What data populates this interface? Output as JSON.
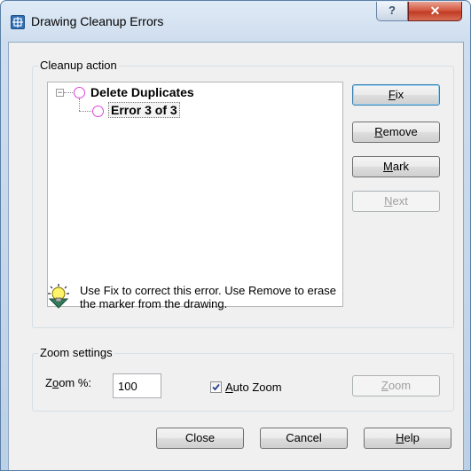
{
  "window": {
    "title": "Drawing Cleanup Errors",
    "help_glyph": "?",
    "close_glyph": "✕"
  },
  "cleanup": {
    "group_label": "Cleanup action",
    "tree": {
      "expander_glyph": "−",
      "root_label": "Delete Duplicates",
      "child_label": "Error 3 of 3",
      "marker_color": "#e043e0"
    },
    "buttons": {
      "fix": {
        "acc": "F",
        "rest": "ix"
      },
      "remove": {
        "acc": "R",
        "rest": "emove"
      },
      "mark": {
        "acc": "M",
        "rest": "ark"
      },
      "next": {
        "acc": "N",
        "rest": "ext"
      }
    },
    "info_text_line1": "Use Fix to correct this error. Use Remove to erase",
    "info_text_line2": " the  marker from the drawing."
  },
  "zoom": {
    "group_label": "Zoom settings",
    "zoom_label_pre": "Z",
    "zoom_label_acc": "o",
    "zoom_label_post": "om %:",
    "zoom_value": "100",
    "auto_zoom": {
      "checked": true,
      "acc": "A",
      "rest": "uto Zoom"
    },
    "zoom_button": {
      "acc": "Z",
      "rest": "oom"
    }
  },
  "footer": {
    "close_label": "Close",
    "cancel_label": "Cancel",
    "help": {
      "acc": "H",
      "rest": "elp"
    }
  },
  "colors": {
    "title_close": "#c13b24",
    "default_button_border": "#3c7fb1",
    "marker": "#e043e0"
  }
}
